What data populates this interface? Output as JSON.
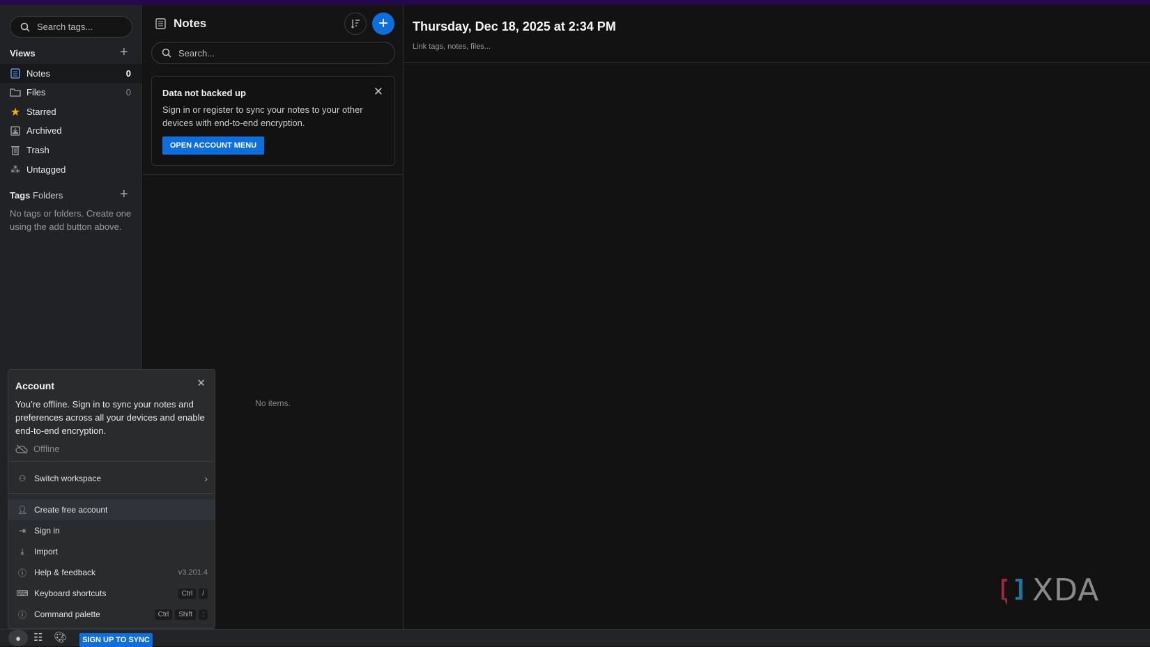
{
  "sidebar": {
    "search_placeholder": "Search tags...",
    "views_label": "Views",
    "items": [
      {
        "label": "Notes",
        "count": "0"
      },
      {
        "label": "Files",
        "count": "0"
      },
      {
        "label": "Starred"
      },
      {
        "label": "Archived"
      },
      {
        "label": "Trash"
      },
      {
        "label": "Untagged"
      }
    ],
    "tags_label": "Tags",
    "folders_label": "Folders",
    "empty_text": "No tags or folders. Create one using the add button above."
  },
  "list": {
    "title": "Notes",
    "search_placeholder": "Search...",
    "banner": {
      "title": "Data not backed up",
      "text": "Sign in or register to sync your notes to your other devices with end-to-end encryption.",
      "button": "OPEN ACCOUNT MENU"
    },
    "empty": "No items."
  },
  "editor": {
    "title": "Thursday, Dec 18, 2025 at 2:34 PM",
    "link_placeholder": "Link tags, notes, files..."
  },
  "account": {
    "title": "Account",
    "text": "You’re offline. Sign in to sync your notes and preferences across all your devices and enable end-to-end encryption.",
    "status": "Offline",
    "switch_workspace": "Switch workspace",
    "items": [
      "Create free account",
      "Sign in",
      "Import",
      "Help & feedback",
      "Keyboard shortcuts",
      "Command palette"
    ],
    "version": "v3.201.4",
    "shortcut_keyboard": [
      "Ctrl",
      "/"
    ],
    "shortcut_palette": [
      "Ctrl",
      "Shift",
      ":"
    ]
  },
  "bottombar": {
    "signup": "SIGN UP TO SYNC"
  },
  "watermark": "XDA",
  "colors": {
    "accent": "#0d6fdc",
    "topbar": "#24094f",
    "star": "#f5b400"
  }
}
